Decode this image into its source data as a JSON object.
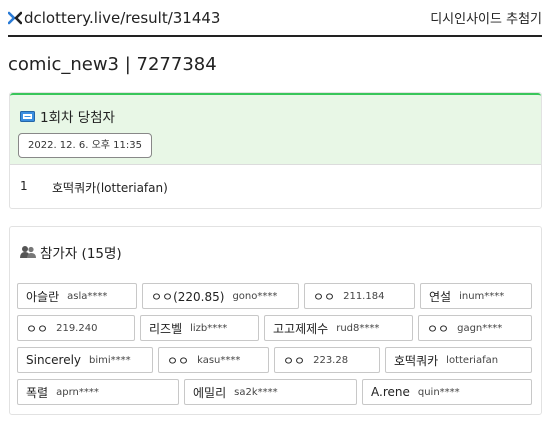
{
  "header": {
    "site": "dclottery.live/result/31443",
    "side_title": "디시인사이드 추첨기"
  },
  "page_title": "comic_new3 | 7277384",
  "winners": {
    "title": "1회차 당첨자",
    "date": "2022. 12. 6. 오후 11:35",
    "list": [
      {
        "rank": "1",
        "name": "호떡쿼카(lotteriafan)"
      }
    ]
  },
  "participants": {
    "title": "참가자 (15명)",
    "list": [
      {
        "nick": "아슬란",
        "uid": "asla****"
      },
      {
        "nick": "ㅇㅇ(220.85)",
        "uid": "gono****"
      },
      {
        "nick": "ㅇㅇ",
        "uid": "211.184"
      },
      {
        "nick": "연설",
        "uid": "inum****"
      },
      {
        "nick": "ㅇㅇ",
        "uid": "219.240"
      },
      {
        "nick": "리즈벨",
        "uid": "lizb****"
      },
      {
        "nick": "고고제제수",
        "uid": "rud8****"
      },
      {
        "nick": "ㅇㅇ",
        "uid": "gagn****"
      },
      {
        "nick": "Sincerely",
        "uid": "bimi****"
      },
      {
        "nick": "ㅇㅇ",
        "uid": "kasu****"
      },
      {
        "nick": "ㅇㅇ",
        "uid": "223.28"
      },
      {
        "nick": "호떡쿼카",
        "uid": "lotteriafan"
      },
      {
        "nick": "폭렬",
        "uid": "aprn****"
      },
      {
        "nick": "에밀리",
        "uid": "sa2k****"
      },
      {
        "nick": "A.rene",
        "uid": "quin****"
      }
    ]
  },
  "colors": {
    "accent_green": "#39c65a",
    "winner_bg": "#e8f7e6",
    "logo_blue": "#2a7bd6"
  }
}
